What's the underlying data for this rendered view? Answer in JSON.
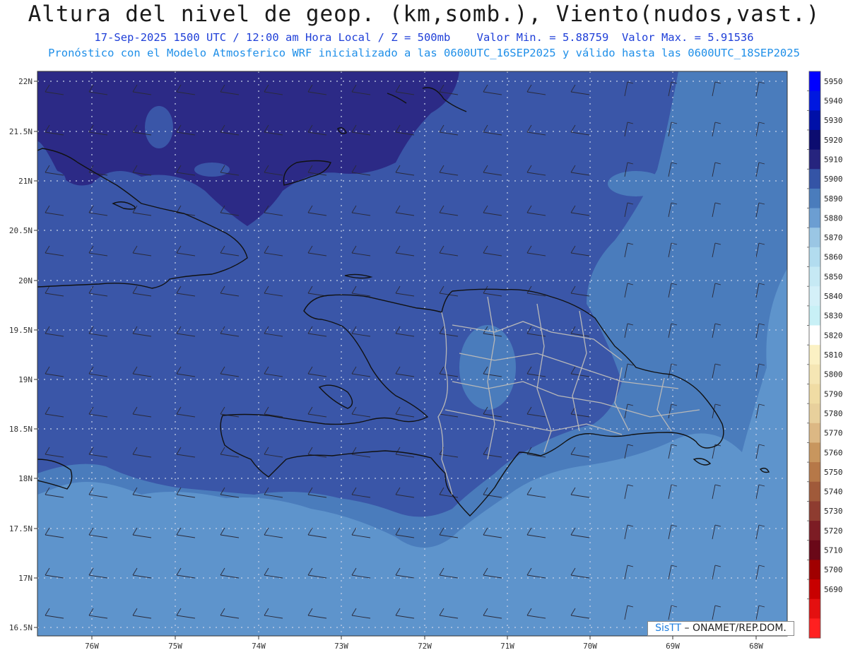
{
  "header": {
    "title": "Altura del nivel de geop. (km,somb.), Viento(nudos,vast.)",
    "date_time": "17-Sep-2025  1500 UTC / 12:00 am Hora Local / Z = 500mb",
    "min_value": "Valor Min. = 5.88759",
    "max_value": "Valor Max. = 5.91536",
    "model_info": "Pronóstico con el Modelo Atmosferico WRF inicializado a las 0600UTC_16SEP2025 y válido hasta las  0600UTC_18SEP2025"
  },
  "map": {
    "lat_ticks": [
      "22N",
      "21.5N",
      "21N",
      "20.5N",
      "20N",
      "19.5N",
      "19N",
      "18.5N",
      "18N",
      "17.5N",
      "17N",
      "16.5N"
    ],
    "lon_ticks": [
      "76W",
      "75W",
      "74W",
      "73W",
      "72W",
      "71W",
      "70W",
      "69W",
      "68W"
    ],
    "colors": {
      "band_5910": "#2c2a86",
      "band_5900": "#3a56a8",
      "band_5890": "#4a7cbc",
      "band_5880": "#5e94cc",
      "coastline": "#111111",
      "province_border": "#b8b8b8"
    }
  },
  "colorbar": {
    "labels": [
      "5950",
      "5940",
      "5930",
      "5920",
      "5910",
      "5900",
      "5890",
      "5880",
      "5870",
      "5860",
      "5850",
      "5840",
      "5830",
      "5820",
      "5810",
      "5800",
      "5790",
      "5780",
      "5770",
      "5760",
      "5750",
      "5740",
      "5730",
      "5720",
      "5710",
      "5700",
      "5690"
    ],
    "colors": [
      "#0000ff",
      "#0018e0",
      "#0010a8",
      "#0c0c70",
      "#26247e",
      "#3454a6",
      "#4a7cbc",
      "#6c9ed2",
      "#9ac6e4",
      "#b2dcef",
      "#c6e9f4",
      "#d4f0f8",
      "#c8f0f6",
      "#ffffff",
      "#fbf1c4",
      "#f5e6b4",
      "#f0dca4",
      "#e8d09c",
      "#dcb884",
      "#c8965e",
      "#b67848",
      "#a05a3a",
      "#8e3c30",
      "#7c1c24",
      "#6a0818",
      "#a00000",
      "#c80000",
      "#e41010",
      "#ff2020"
    ]
  },
  "credit": {
    "brand": "SisTT",
    "org": " – ONAMET/REP.DOM."
  }
}
